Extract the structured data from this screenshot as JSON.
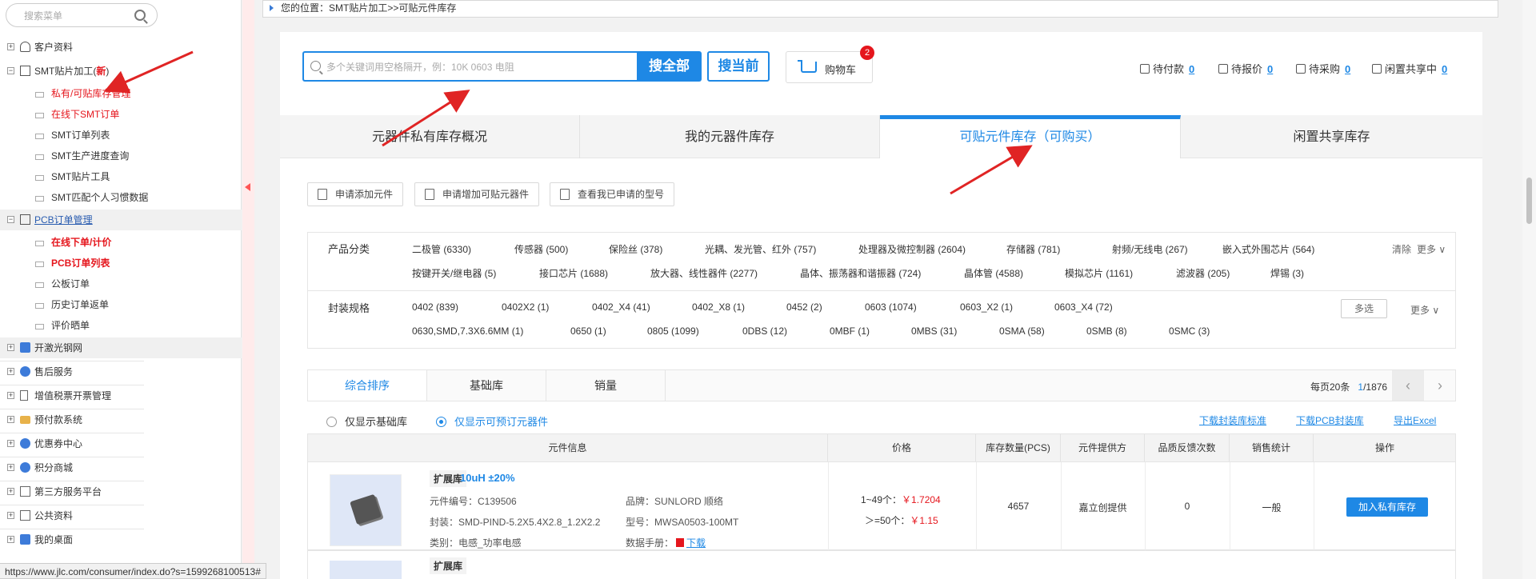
{
  "sidebar": {
    "search_placeholder": "搜索菜单",
    "items": [
      {
        "label": "客户资料"
      },
      {
        "label": "SMT贴片加工(",
        "badge": "新",
        "suffix": ")"
      },
      {
        "label": "私有/可贴库存管理"
      },
      {
        "label": "在线下SMT订单"
      },
      {
        "label": "SMT订单列表"
      },
      {
        "label": "SMT生产进度查询"
      },
      {
        "label": "SMT贴片工具"
      },
      {
        "label": "SMT匹配个人习惯数据"
      },
      {
        "label": "PCB订单管理"
      },
      {
        "label": "在线下单/计价"
      },
      {
        "label": "PCB订单列表"
      },
      {
        "label": "公板订单"
      },
      {
        "label": "历史订单返单"
      },
      {
        "label": "评价晒单"
      },
      {
        "label": "开激光钢网"
      },
      {
        "label": "售后服务"
      },
      {
        "label": "增值税票开票管理"
      },
      {
        "label": "预付款系统"
      },
      {
        "label": "优惠券中心"
      },
      {
        "label": "积分商城"
      },
      {
        "label": "第三方服务平台"
      },
      {
        "label": "公共资料"
      },
      {
        "label": "我的桌面"
      }
    ]
  },
  "status_url": "https://www.jlc.com/consumer/index.do?s=1599268100513#",
  "breadcrumb": "您的位置：SMT贴片加工>>可贴元件库存",
  "search": {
    "placeholder": "多个关键词用空格隔开，例：10K 0603 电阻",
    "btn_all": "搜全部",
    "btn_current": "搜当前"
  },
  "cart": {
    "label": "购物车",
    "count": "2"
  },
  "status_counts": [
    {
      "label": "待付款",
      "value": "0"
    },
    {
      "label": "待报价",
      "value": "0"
    },
    {
      "label": "待采购",
      "value": "0"
    },
    {
      "label": "闲置共享中",
      "value": "0"
    }
  ],
  "tabs": [
    {
      "label": "元器件私有库存概况"
    },
    {
      "label": "我的元器件库存"
    },
    {
      "label": "可贴元件库存（可购买）"
    },
    {
      "label": "闲置共享库存"
    }
  ],
  "actions": [
    {
      "label": "申请添加元件"
    },
    {
      "label": "申请增加可贴元器件"
    },
    {
      "label": "查看我已申请的型号"
    }
  ],
  "filters": {
    "category_label": "产品分类",
    "categories": [
      "二极管 (6330)",
      "传感器 (500)",
      "保险丝 (378)",
      "光耦、发光管、红外 (757)",
      "处理器及微控制器 (2604)",
      "存储器 (781)",
      "射频/无线电 (267)",
      "嵌入式外围芯片 (564)",
      "按键开关/继电器 (5)",
      "接口芯片 (1688)",
      "放大器、线性器件 (2277)",
      "晶体、振荡器和谐振器 (724)",
      "晶体管 (4588)",
      "模拟芯片 (1161)",
      "滤波器 (205)",
      "焊锡 (3)"
    ],
    "clear": "清除",
    "more": "更多",
    "package_label": "封装规格",
    "packages": [
      "0402 (839)",
      "0402X2 (1)",
      "0402_X4 (41)",
      "0402_X8 (1)",
      "0452 (2)",
      "0603 (1074)",
      "0603_X2 (1)",
      "0603_X4 (72)",
      "0630,SMD,7.3X6.6MM (1)",
      "0650 (1)",
      "0805 (1099)",
      "0DBS (12)",
      "0MBF (1)",
      "0MBS (31)",
      "0SMA (58)",
      "0SMB (8)",
      "0SMC (3)"
    ],
    "multi": "多选",
    "more2": "更多"
  },
  "sort_tabs": [
    {
      "label": "综合排序"
    },
    {
      "label": "基础库"
    },
    {
      "label": "销量"
    }
  ],
  "pagination": {
    "per_page": "每页20条",
    "current": "1",
    "total": "/1876"
  },
  "radios": [
    {
      "label": "仅显示基础库",
      "checked": false
    },
    {
      "label": "仅显示可预订元器件",
      "checked": true
    }
  ],
  "links": [
    "下载封装库标准",
    "下载PCB封装库",
    "导出Excel"
  ],
  "table": {
    "headers": [
      "元件信息",
      "价格",
      "库存数量(PCS)",
      "元件提供方",
      "品质反馈次数",
      "销售统计",
      "操作"
    ],
    "row": {
      "tag": "扩展库",
      "name": "10uH ±20%",
      "code": "元件编号：C139506",
      "brand": "品牌：SUNLORD 顺络",
      "package": "封装：SMD-PIND-5.2X5.4X2.8_1.2X2.2",
      "model": "型号：MWSA0503-100MT",
      "category": "类别：电感_功率电感",
      "datasheet": "数据手册：",
      "download": "下载",
      "price1_label": "1~49个：",
      "price1": "￥1.7204",
      "price2_label": "＞=50个：",
      "price2": "￥1.15",
      "stock": "4657",
      "provider": "嘉立创提供",
      "feedback": "0",
      "sales": "一般",
      "action": "加入私有库存"
    },
    "row2_tag": "扩展库"
  },
  "colors": {
    "accent": "#1e88e5",
    "alert": "#e5161d",
    "annotation": "#e02424"
  }
}
